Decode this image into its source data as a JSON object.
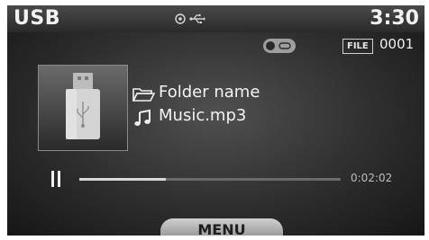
{
  "status_bar": {
    "source": "USB",
    "clock": "3:30",
    "icons": [
      "disc-indicator-icon",
      "usb-icon"
    ]
  },
  "info_bar": {
    "repeat_icon": "repeat-mode-icon",
    "file_label": "FILE",
    "file_number": "0001"
  },
  "album_art": {
    "icon": "usb-stick-icon"
  },
  "track_info": {
    "folder_icon": "folder-icon",
    "folder_name": "Folder name",
    "music_icon": "music-note-icon",
    "file_name": "Music.mp3"
  },
  "playback": {
    "state_icon": "pause-icon",
    "progress_fraction": 0.33,
    "elapsed": "0:02:02"
  },
  "menu": {
    "label": "MENU"
  },
  "colors": {
    "screen": "#000000",
    "text": "#f2f2f2",
    "menu_tab": "#c4c4c4"
  }
}
